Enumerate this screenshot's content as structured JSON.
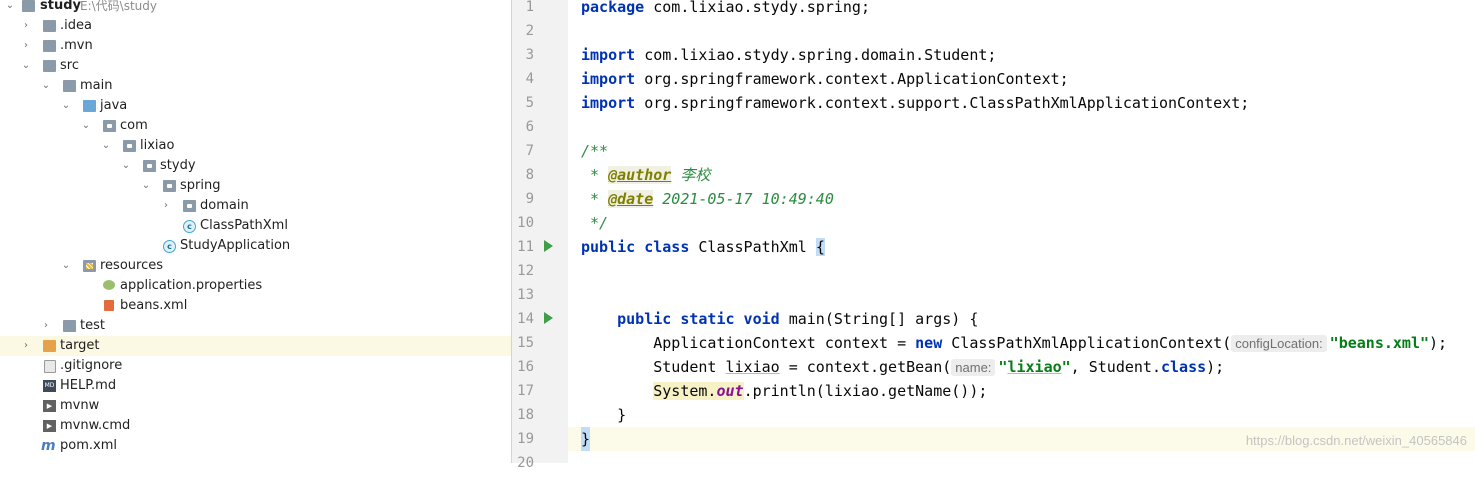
{
  "project_tree": {
    "root": {
      "name": "study",
      "path": "E:\\代码\\study"
    },
    "nodes": [
      {
        "label": ".idea"
      },
      {
        "label": ".mvn"
      },
      {
        "label": "src"
      },
      {
        "label": "main"
      },
      {
        "label": "java"
      },
      {
        "label": "com"
      },
      {
        "label": "lixiao"
      },
      {
        "label": "stydy"
      },
      {
        "label": "spring"
      },
      {
        "label": "domain"
      },
      {
        "label": "ClassPathXml"
      },
      {
        "label": "StudyApplication"
      },
      {
        "label": "resources"
      },
      {
        "label": "application.properties"
      },
      {
        "label": "beans.xml"
      },
      {
        "label": "test"
      },
      {
        "label": "target"
      },
      {
        "label": ".gitignore"
      },
      {
        "label": "HELP.md"
      },
      {
        "label": "mvnw"
      },
      {
        "label": "mvnw.cmd"
      },
      {
        "label": "pom.xml"
      }
    ],
    "selected": "target"
  },
  "editor": {
    "line_numbers": [
      "1",
      "2",
      "3",
      "4",
      "5",
      "6",
      "7",
      "8",
      "9",
      "10",
      "11",
      "12",
      "13",
      "14",
      "15",
      "16",
      "17",
      "18",
      "19",
      "20"
    ],
    "current_line": "19",
    "code": {
      "l1_kw": "package",
      "l1_rest": " com.lixiao.stydy.spring;",
      "l3_kw": "import",
      "l3_rest": " com.lixiao.stydy.spring.domain.Student;",
      "l4_kw": "import",
      "l4_rest": " org.springframework.context.ApplicationContext;",
      "l5_kw": "import",
      "l5_rest": " org.springframework.context.support.ClassPathXmlApplicationContext;",
      "l7": "/**",
      "l8_pre": " * ",
      "l8_tag": "@author",
      "l8_val": " 李校",
      "l9_pre": " * ",
      "l9_tag": "@date",
      "l9_val": " 2021-05-17 10:49:40",
      "l10": " */",
      "l11_kw": "public class",
      "l11_name": " ClassPathXml ",
      "l11_brace": "{",
      "l14_kw": "    public static void",
      "l14_rest": " main(String[] args) {",
      "l15_a": "        ApplicationContext context = ",
      "l15_kw": "new",
      "l15_b": " ClassPathXmlApplicationContext(",
      "l15_hint": "configLocation:",
      "l15_str": "\"beans.xml\"",
      "l15_end": ");",
      "l16_a": "        Student ",
      "l16_var": "lixiao",
      "l16_b": " = context.getBean(",
      "l16_hint": "name:",
      "l16_str_q1": "\"",
      "l16_str_v": "lixiao",
      "l16_str_q2": "\"",
      "l16_c": ", Student.",
      "l16_kw": "class",
      "l16_end": ");",
      "l17_sys": "System.",
      "l17_out": "out",
      "l17_rest": ".println(lixiao.getName());",
      "l18": "    }",
      "l19": "}"
    }
  },
  "watermark": "https://blog.csdn.net/weixin_40565846"
}
